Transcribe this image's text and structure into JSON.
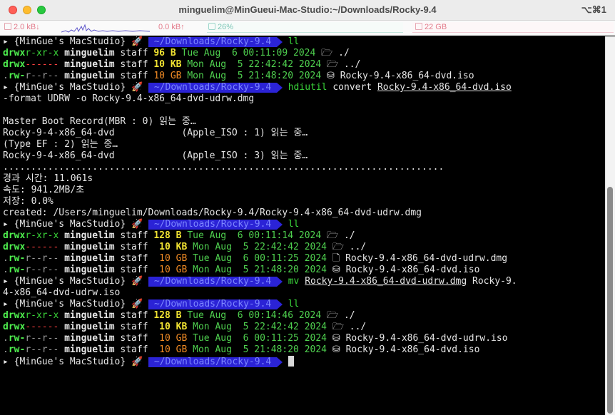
{
  "window": {
    "title": "minguelim@MinGueui-Mac-Studio:~/Downloads/Rocky-9.4",
    "shortcut": "⌥⌘1"
  },
  "status": {
    "net_down": "2.0 kB↓",
    "net_up": "0.0 kB↑",
    "cpu": "26%",
    "mem": "22 GB"
  },
  "prompt": {
    "host": "{MinGue's MacStudio}",
    "rocket": "🚀",
    "path": " ~/Downloads/Rocky-9.4 "
  },
  "commands": {
    "ll": "ll",
    "hdiutil": "hdiutil",
    "hdiutil_arg1": "convert",
    "hdiutil_file": "Rocky-9.4-x86_64-dvd.iso",
    "hdiutil_cont": "-format UDRW -o Rocky-9.4-x86_64-dvd-udrw.dmg",
    "mv": "mv",
    "mv_file": "Rocky-9.4-x86_64-dvd-udrw.dmg",
    "mv_dest": " Rocky-9.",
    "mv_dest_cont": "4-x86_64-dvd-udrw.iso"
  },
  "listing1": [
    {
      "perm": [
        "d",
        "rwx",
        "r-x",
        "r-x"
      ],
      "user": "minguelim",
      "group": "staff",
      "size": "96 B",
      "date": "Tue Aug  6 00:11:09 2024",
      "icon": "🗁",
      "name": "./"
    },
    {
      "perm": [
        "d",
        "rwx",
        "---",
        "---"
      ],
      "user": "minguelim",
      "group": "staff",
      "size": "10 KB",
      "date": "Mon Aug  5 22:42:42 2024",
      "icon": "🗁",
      "name": "../"
    },
    {
      "perm": [
        ".",
        "rw-",
        "r--",
        "r--"
      ],
      "user": "minguelim",
      "group": "staff",
      "size": "10 GB",
      "date": "Mon Aug  5 21:48:20 2024",
      "icon": "⛁",
      "name": "Rocky-9.4-x86_64-dvd.iso"
    }
  ],
  "hdiutil_output": [
    "Master Boot Record(MBR : 0) 읽는 중…",
    "Rocky-9-4-x86_64-dvd            (Apple_ISO : 1) 읽는 중…",
    "(Type EF : 2) 읽는 중…",
    "Rocky-9-4-x86_64-dvd            (Apple_ISO : 3) 읽는 중…",
    "...............................................................................",
    "경과 시간: 11.061s",
    "속도: 941.2MB/초",
    "저장: 0.0%",
    "created: /Users/minguelim/Downloads/Rocky-9.4/Rocky-9.4-x86_64-dvd-udrw.dmg"
  ],
  "listing2": [
    {
      "perm": [
        "d",
        "rwx",
        "r-x",
        "r-x"
      ],
      "user": "minguelim",
      "group": "staff",
      "size": "128 B",
      "date": "Tue Aug  6 00:11:14 2024",
      "icon": "🗁",
      "name": "./"
    },
    {
      "perm": [
        "d",
        "rwx",
        "---",
        "---"
      ],
      "user": "minguelim",
      "group": "staff",
      "size": " 10 KB",
      "date": "Mon Aug  5 22:42:42 2024",
      "icon": "🗁",
      "name": "../"
    },
    {
      "perm": [
        ".",
        "rw-",
        "r--",
        "r--"
      ],
      "user": "minguelim",
      "group": "staff",
      "size": " 10 GB",
      "date": "Tue Aug  6 00:11:25 2024",
      "icon": "🗋",
      "name": "Rocky-9.4-x86_64-dvd-udrw.dmg"
    },
    {
      "perm": [
        ".",
        "rw-",
        "r--",
        "r--"
      ],
      "user": "minguelim",
      "group": "staff",
      "size": " 10 GB",
      "date": "Mon Aug  5 21:48:20 2024",
      "icon": "⛁",
      "name": "Rocky-9.4-x86_64-dvd.iso"
    }
  ],
  "listing3": [
    {
      "perm": [
        "d",
        "rwx",
        "r-x",
        "r-x"
      ],
      "user": "minguelim",
      "group": "staff",
      "size": "128 B",
      "date": "Tue Aug  6 00:14:46 2024",
      "icon": "🗁",
      "name": "./"
    },
    {
      "perm": [
        "d",
        "rwx",
        "---",
        "---"
      ],
      "user": "minguelim",
      "group": "staff",
      "size": " 10 KB",
      "date": "Mon Aug  5 22:42:42 2024",
      "icon": "🗁",
      "name": "../"
    },
    {
      "perm": [
        ".",
        "rw-",
        "r--",
        "r--"
      ],
      "user": "minguelim",
      "group": "staff",
      "size": " 10 GB",
      "date": "Tue Aug  6 00:11:25 2024",
      "icon": "⛁",
      "name": "Rocky-9.4-x86_64-dvd-udrw.iso"
    },
    {
      "perm": [
        ".",
        "rw-",
        "r--",
        "r--"
      ],
      "user": "minguelim",
      "group": "staff",
      "size": " 10 GB",
      "date": "Mon Aug  5 21:48:20 2024",
      "icon": "⛁",
      "name": "Rocky-9.4-x86_64-dvd.iso"
    }
  ],
  "colors": {
    "path_bg": "#2b23d6",
    "path_fg": "#7c86ff",
    "command": "#3ad63a",
    "size_gb": "#f08a24",
    "size_kb_b": "#f1e332"
  }
}
